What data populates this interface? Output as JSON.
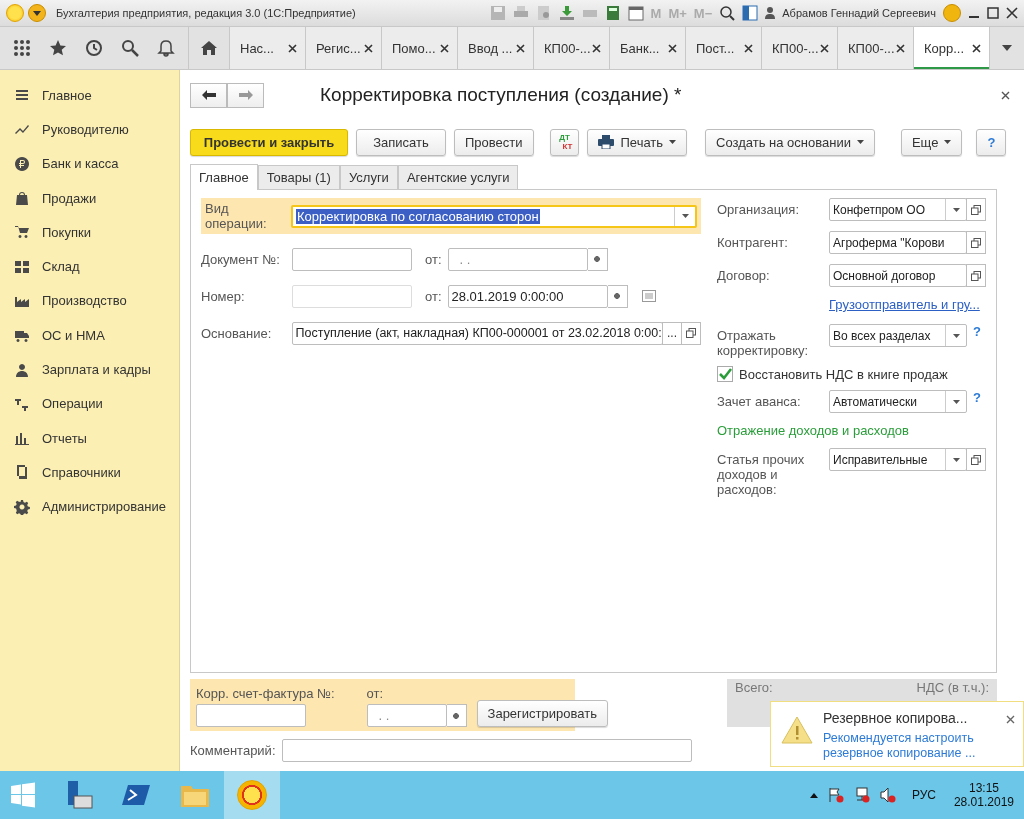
{
  "window": {
    "title": "Бухгалтерия предприятия, редакция 3.0  (1С:Предприятие)",
    "memory_buttons": [
      "M",
      "M+",
      "M−"
    ],
    "user": "Абрамов Геннадий Сергеевич"
  },
  "open_tabs": [
    {
      "label": "Нас...",
      "selected": false
    },
    {
      "label": "Регис...",
      "selected": false
    },
    {
      "label": "Помо...",
      "selected": false
    },
    {
      "label": "Ввод ...",
      "selected": false
    },
    {
      "label": "КП00-...",
      "selected": false
    },
    {
      "label": "Банк...",
      "selected": false
    },
    {
      "label": "Пост...",
      "selected": false
    },
    {
      "label": "КП00-...",
      "selected": false
    },
    {
      "label": "КП00-...",
      "selected": false
    },
    {
      "label": "Корр...",
      "selected": true
    }
  ],
  "sidebar": {
    "items": [
      {
        "label": "Главное"
      },
      {
        "label": "Руководителю"
      },
      {
        "label": "Банк и касса"
      },
      {
        "label": "Продажи"
      },
      {
        "label": "Покупки"
      },
      {
        "label": "Склад"
      },
      {
        "label": "Производство"
      },
      {
        "label": "ОС и НМА"
      },
      {
        "label": "Зарплата и кадры"
      },
      {
        "label": "Операции"
      },
      {
        "label": "Отчеты"
      },
      {
        "label": "Справочники"
      },
      {
        "label": "Администрирование"
      }
    ]
  },
  "document": {
    "title": "Корректировка поступления (создание) *",
    "toolbar": [
      {
        "kind": "primary",
        "label": "Провести и закрыть"
      },
      {
        "kind": "plain",
        "label": "Записать"
      },
      {
        "kind": "plain",
        "label": "Провести"
      },
      {
        "kind": "dtkt",
        "label": "ДТ",
        "label2": "КТ"
      },
      {
        "kind": "print",
        "label": "Печать"
      },
      {
        "kind": "menu",
        "label": "Создать на основании"
      },
      {
        "kind": "menu",
        "label": "Еще"
      },
      {
        "kind": "plain",
        "label": "?"
      }
    ],
    "form_tabs": [
      {
        "label": "Главное",
        "selected": true
      },
      {
        "label": "Товары (1)",
        "selected": false
      },
      {
        "label": "Услуги",
        "selected": false
      },
      {
        "label": "Агентские услуги",
        "selected": false
      }
    ],
    "operation": {
      "label": "Вид операции:",
      "value": "Корректировка по согласованию сторон"
    },
    "doc_number": {
      "label": "Документ №:",
      "date_label": "от:",
      "date": ". ."
    },
    "number": {
      "label": "Номер:",
      "date_label": "от:",
      "date": "28.01.2019  0:00:00"
    },
    "basis": {
      "label": "Основание:",
      "value": "Поступление (акт, накладная) КП00-000001 от 23.02.2018 0:00:",
      "choose": "..."
    },
    "right": [
      {
        "kind": "field",
        "label": "Организация:",
        "value": "Конфетпром ОО",
        "dropdown": true,
        "open": true
      },
      {
        "kind": "field",
        "label": "Контрагент:",
        "value": "Агроферма \"Корови",
        "dropdown": false,
        "open": true
      },
      {
        "kind": "field",
        "label": "Договор:",
        "value": "Основной договор",
        "dropdown": false,
        "open": true
      },
      {
        "kind": "link",
        "label": "Грузоотправитель и гру..."
      },
      {
        "kind": "field",
        "label": "Отражать корректировку:",
        "value": "Во всех разделах",
        "dropdown": true,
        "open": false,
        "help": "?"
      },
      {
        "kind": "checkbox",
        "label": "Восстановить НДС в книге продаж",
        "checked": true
      },
      {
        "kind": "field",
        "label": "Зачет аванса:",
        "value": "Автоматически",
        "dropdown": true,
        "open": false,
        "help": "?"
      },
      {
        "kind": "heading",
        "label": "Отражение доходов и расходов"
      },
      {
        "kind": "field",
        "label": "Статья прочих доходов и расходов:",
        "value": "Исправительные",
        "dropdown": true,
        "open": true
      }
    ],
    "invoice": {
      "label": "Корр. счет-фактура №:",
      "date_label": "от:",
      "date": ". .",
      "button": "Зарегистрировать"
    },
    "totals": {
      "total_label": "Всего:",
      "vat_label": "НДС (в т.ч.):"
    },
    "comment": {
      "label": "Комментарий:"
    }
  },
  "notification": {
    "title": "Резервное копирова...",
    "link": "Рекомендуется настроить резервное копирование ..."
  },
  "taskbar": {
    "language": "РУС",
    "time": "13:15",
    "date": "28.01.2019"
  }
}
